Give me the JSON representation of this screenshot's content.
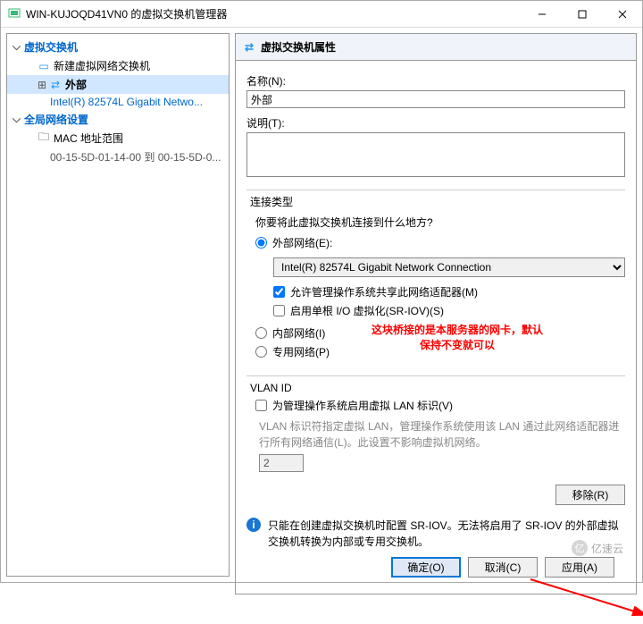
{
  "window": {
    "title": "WIN-KUJOQD41VN0 的虚拟交换机管理器"
  },
  "sidebar": {
    "section1": {
      "title": "虚拟交换机"
    },
    "item_new": "新建虚拟网络交换机",
    "item_external": "外部",
    "item_external_adapter": "Intel(R) 82574L Gigabit Netwo...",
    "section2": {
      "title": "全局网络设置"
    },
    "item_mac": "MAC 地址范围",
    "item_mac_range": "00-15-5D-01-14-00 到 00-15-5D-0..."
  },
  "props": {
    "header": "虚拟交换机属性",
    "name_label": "名称(N):",
    "name_value": "外部",
    "desc_label": "说明(T):",
    "desc_value": ""
  },
  "conn": {
    "group_title": "连接类型",
    "question": "你要将此虚拟交换机连接到什么地方?",
    "external": "外部网络(E):",
    "adapter": "Intel(R) 82574L Gigabit Network Connection",
    "allow_mgmt": "允许管理操作系统共享此网络适配器(M)",
    "sriov": "启用单根 I/O 虚拟化(SR-IOV)(S)",
    "internal": "内部网络(I)",
    "private": "专用网络(P)",
    "annotation_line1": "这块桥接的是本服务器的网卡，默认",
    "annotation_line2": "保持不变就可以"
  },
  "vlan": {
    "group_title": "VLAN ID",
    "enable": "为管理操作系统启用虚拟 LAN 标识(V)",
    "hint": "VLAN 标识符指定虚拟 LAN，管理操作系统使用该 LAN 通过此网络适配器进行所有网络通信(L)。此设置不影响虚拟机网络。",
    "value": "2"
  },
  "buttons": {
    "remove": "移除(R)",
    "ok": "确定(O)",
    "cancel": "取消(C)",
    "apply": "应用(A)"
  },
  "info": {
    "text": "只能在创建虚拟交换机时配置 SR-IOV。无法将启用了 SR-IOV 的外部虚拟交换机转换为内部或专用交换机。"
  },
  "watermark": "亿速云"
}
